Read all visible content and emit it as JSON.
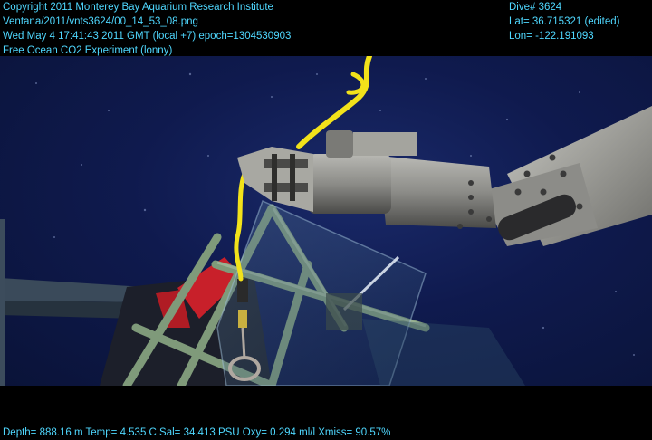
{
  "overlay": {
    "top_left": [
      "Copyright 2011 Monterey Bay Aquarium Research Institute",
      "Ventana/2011/vnts3624/00_14_53_08.png",
      "Wed May  4 17:41:43 2011 GMT (local +7)  epoch=1304530903",
      "Free Ocean CO2 Experiment (lonny)"
    ],
    "top_right": [
      "Dive# 3624",
      "Lat= 36.715321 (edited)",
      "Lon= -122.191093"
    ],
    "bottom": "Depth= 888.16 m  Temp= 4.535 C  Sal= 34.413 PSU  Oxy= 0.294 ml/l  Xmiss= 90.57%"
  },
  "colors": {
    "overlay_text": "#4fd8ff",
    "water": "#0f1a4e",
    "rope": "#f2e21a",
    "arm": "#9a9a96",
    "frame_green": "#7f9a7a",
    "red_panel": "#c8202a"
  },
  "scene": {
    "subjects": [
      "rov-manipulator-arm",
      "yellow-rope",
      "experiment-frame",
      "clear-panel"
    ]
  }
}
